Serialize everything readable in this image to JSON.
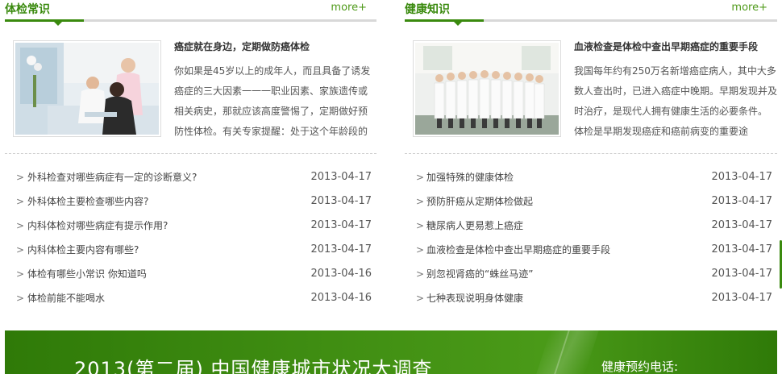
{
  "left_panel": {
    "title": "体检常识",
    "more": "more+",
    "feature": {
      "title": "癌症就在身边，定期做防癌体检",
      "body": "你如果是45岁以上的成年人，而且具备了诱发癌症的三大因素一一一职业因素、家族遗传或相关病史，那就应该高度警惕了，定期做好预防性体检。有关专家提醒：处于这个年龄段的"
    },
    "items": [
      {
        "title": "外科检查对哪些病症有一定的诊断意义?",
        "date": "2013-04-17"
      },
      {
        "title": "外科体检主要检查哪些内容?",
        "date": "2013-04-17"
      },
      {
        "title": "内科体检对哪些病症有提示作用?",
        "date": "2013-04-17"
      },
      {
        "title": "内科体检主要内容有哪些?",
        "date": "2013-04-17"
      },
      {
        "title": "体检有哪些小常识 你知道吗",
        "date": "2013-04-16"
      },
      {
        "title": "体检前能不能喝水",
        "date": "2013-04-16"
      }
    ]
  },
  "right_panel": {
    "title": "健康知识",
    "more": "more+",
    "feature": {
      "title": "血液检查是体检中查出早期癌症的重要手段",
      "body": "我国每年约有250万名新增癌症病人，其中大多数人查出时，已进入癌症中晚期。早期发现并及时治疗，是现代人拥有健康生活的必要条件。 体检是早期发现癌症和癌前病变的重要途"
    },
    "items": [
      {
        "title": "加强特殊的健康体检",
        "date": "2013-04-17"
      },
      {
        "title": "预防肝癌从定期体检做起",
        "date": "2013-04-17"
      },
      {
        "title": "糖尿病人更易惹上癌症",
        "date": "2013-04-17"
      },
      {
        "title": "血液检查是体检中查出早期癌症的重要手段",
        "date": "2013-04-17"
      },
      {
        "title": "别忽视肾癌的“蛛丝马迹”",
        "date": "2013-04-17"
      },
      {
        "title": "七种表现说明身体健康",
        "date": "2013-04-17"
      }
    ]
  },
  "banner": {
    "title": "2013(第二届) 中国健康城市状况大调查",
    "phone_label": "健康预约电话:"
  },
  "colors": {
    "accent": "#3a8a0e",
    "banner": "#3f8d12"
  },
  "icons": {
    "list_arrow": "chevron-right-icon"
  }
}
